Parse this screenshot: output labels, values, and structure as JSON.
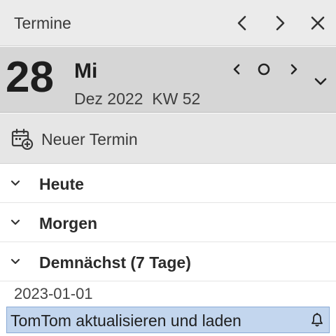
{
  "panel": {
    "title": "Termine",
    "buttons": {
      "prev": "chevron-left-icon",
      "next": "chevron-right-icon",
      "close": "close-icon"
    }
  },
  "date_header": {
    "day": "28",
    "weekday": "Mi",
    "month_year": "Dez 2022",
    "week": "KW 52",
    "nav": {
      "prev": "chevron-left-icon",
      "today": "circle-icon",
      "next": "chevron-right-icon",
      "expand": "chevron-down-icon"
    }
  },
  "new_event": {
    "label": "Neuer Termin",
    "icon": "calendar-add-icon"
  },
  "sections": [
    {
      "label": "Heute"
    },
    {
      "label": "Morgen"
    },
    {
      "label": "Demnächst (7 Tage)"
    }
  ],
  "agenda": {
    "date": "2023-01-01",
    "items": [
      {
        "title": "TomTom aktualisieren und laden",
        "icon": "bell-icon"
      }
    ]
  },
  "colors": {
    "titlebar": "#ebebeb",
    "date_header": "#d6d6d6",
    "selected_item": "#c3d6ee",
    "selected_border": "#8aaad6"
  }
}
